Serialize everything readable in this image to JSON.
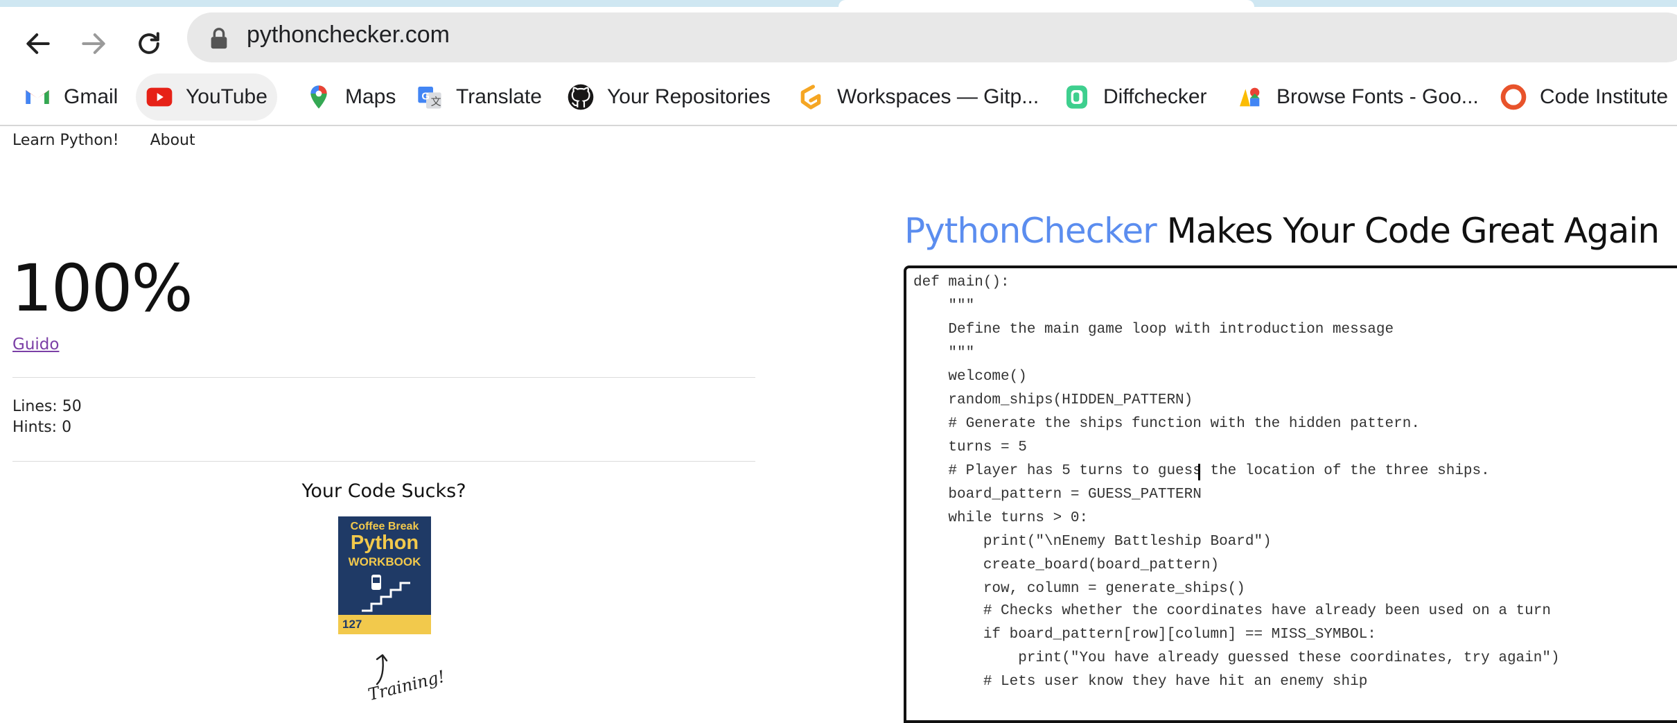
{
  "browser": {
    "url": "pythonchecker.com",
    "bookmarks": [
      {
        "label": "Gmail",
        "icon": "gmail-icon"
      },
      {
        "label": "YouTube",
        "icon": "youtube-icon"
      },
      {
        "label": "Maps",
        "icon": "maps-icon"
      },
      {
        "label": "Translate",
        "icon": "translate-icon"
      },
      {
        "label": "Your Repositories",
        "icon": "github-icon"
      },
      {
        "label": "Workspaces — Gitp...",
        "icon": "gitpod-icon"
      },
      {
        "label": "Diffchecker",
        "icon": "diffchecker-icon"
      },
      {
        "label": "Browse Fonts - Goo...",
        "icon": "google-fonts-icon"
      },
      {
        "label": "Code Institute",
        "icon": "code-institute-icon"
      }
    ]
  },
  "nav": {
    "learn": "Learn Python!",
    "about": "About"
  },
  "result": {
    "score": "100%",
    "author": "Guido",
    "lines": "Lines: 50",
    "hints": "Hints: 0"
  },
  "promo": {
    "heading": "Your Code Sucks?",
    "book_line1": "Coffee Break",
    "book_line2": "Python",
    "book_line3": "WORKBOOK",
    "book_number": "127",
    "handwriting": "Training!"
  },
  "headline": {
    "brand": "PythonChecker",
    "rest": " Makes Your Code Great Again"
  },
  "colors": {
    "brand": "#5b8def",
    "link_visited": "#7b3fa6",
    "spellcheck": "#e06080"
  },
  "code": {
    "lines": [
      "def main():",
      "    \"\"\"",
      "    Define the main game loop with introduction message",
      "    \"\"\"",
      "    welcome()",
      "    random_ships(HIDDEN_PATTERN)",
      "    # Generate the ships function with the hidden pattern.",
      "    turns = 5",
      "    # Player has 5 turns to guess the location of the three ships.",
      "    board_pattern = GUESS_PATTERN",
      "    while turns > 0:",
      "        print(\"\\nEnemy Battleship Board\")",
      "        create_board(board_pattern)",
      "        row, column = generate_ships()",
      "        # Checks whether the coordinates have already been used on a turn",
      "        if board_pattern[row][column] == MISS_SYMBOL:",
      "            print(\"You have already guessed these coordinates, try again\")",
      "        # Lets user know they have hit an enemy ship"
    ]
  }
}
